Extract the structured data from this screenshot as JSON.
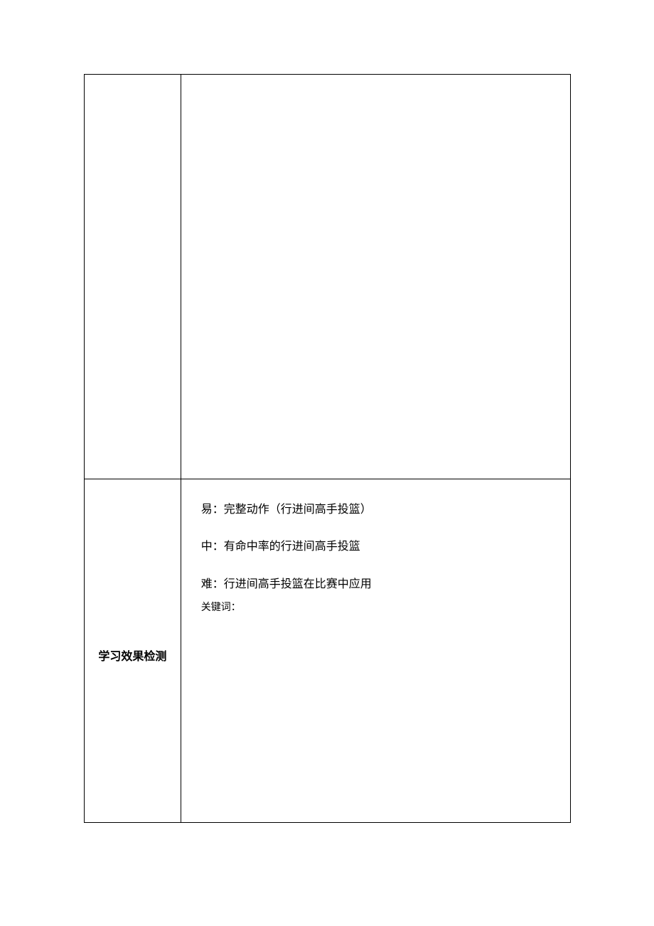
{
  "table": {
    "row1": {
      "label": "",
      "content": ""
    },
    "row2": {
      "label": "学习效果检测",
      "content": {
        "line_easy": "易：完整动作（行进间高手投篮）",
        "line_medium": "中：有命中率的行进间高手投篮",
        "line_hard": "难：行进间高手投篮在比赛中应用",
        "keyword_label": "关键词："
      }
    }
  }
}
